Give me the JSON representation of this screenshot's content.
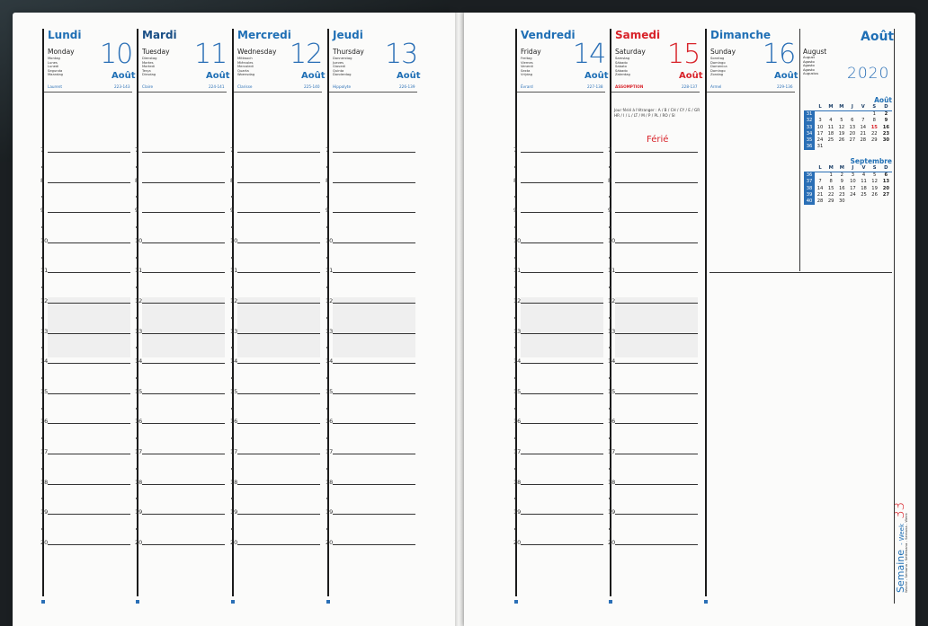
{
  "left_days": [
    {
      "name": "Lundi",
      "trans": "Monday",
      "langs": [
        "Montag",
        "Lunes",
        "Lunedi",
        "Segunda",
        "Maandag"
      ],
      "num": "10",
      "month": "Août",
      "saint": "Laurent",
      "code": "223-143",
      "style": "blue"
    },
    {
      "name": "Mardi",
      "trans": "Tuesday",
      "langs": [
        "Dienstag",
        "Martes",
        "Martedi",
        "Terça",
        "Dinsdag"
      ],
      "num": "11",
      "month": "Août",
      "saint": "Claire",
      "code": "224-141",
      "style": "dark"
    },
    {
      "name": "Mercredi",
      "trans": "Wednesday",
      "langs": [
        "Mittwoch",
        "Miércoles",
        "Mercoledi",
        "Quarta",
        "Woensdag"
      ],
      "num": "12",
      "month": "Août",
      "saint": "Clarisse",
      "code": "225-140",
      "style": "blue"
    },
    {
      "name": "Jeudi",
      "trans": "Thursday",
      "langs": [
        "Donnerstag",
        "Jueves",
        "Giovedi",
        "Quinta",
        "Donderdag"
      ],
      "num": "13",
      "month": "Août",
      "saint": "Hippolyte",
      "code": "226-139",
      "style": "blue"
    }
  ],
  "right_days": [
    {
      "name": "Vendredi",
      "trans": "Friday",
      "langs": [
        "Freitag",
        "Viernes",
        "Venerdi",
        "Sexta",
        "Vrijdag"
      ],
      "num": "14",
      "month": "Août",
      "saint": "Évrard",
      "code": "227-138",
      "style": "blue"
    },
    {
      "name": "Samedi",
      "trans": "Saturday",
      "langs": [
        "Samstag",
        "Sábado",
        "Sabato",
        "Sábado",
        "Zaterdag"
      ],
      "num": "15",
      "month": "Août",
      "saint": "ASSOMPTION",
      "code": "228-137",
      "style": "red"
    },
    {
      "name": "Dimanche",
      "trans": "Sunday",
      "langs": [
        "Sonntag",
        "Domingo",
        "Domenica",
        "Domingo",
        "Zondag"
      ],
      "num": "16",
      "month": "Août",
      "saint": "Armel",
      "code": "229-136",
      "style": "blue"
    }
  ],
  "month_panel": {
    "title": "Août",
    "trans": "August",
    "langs": [
      "August",
      "Agosto",
      "Agosto",
      "Agosto",
      "Augustus"
    ],
    "year": "2020"
  },
  "hours": [
    "7",
    "8",
    "9",
    "10",
    "11",
    "12",
    "13",
    "14",
    "15",
    "16",
    "17",
    "18",
    "19",
    "20"
  ],
  "saturday_note": "Jour férié à l'étranger : A / B / CH / CY / E / GR HR / I / L / LT / M / P / PL / RO / SI",
  "ferie_label": "Férié",
  "mini_calendars": [
    {
      "title": "Août",
      "headers": [
        "L",
        "M",
        "M",
        "J",
        "V",
        "S",
        "D"
      ],
      "rows": [
        {
          "wk": "31",
          "days": [
            "",
            "",
            "",
            "",
            "",
            "1",
            "2"
          ]
        },
        {
          "wk": "32",
          "days": [
            "3",
            "4",
            "5",
            "6",
            "7",
            "8",
            "9"
          ]
        },
        {
          "wk": "33",
          "days": [
            "10",
            "11",
            "12",
            "13",
            "14",
            "15",
            "16"
          ]
        },
        {
          "wk": "34",
          "days": [
            "17",
            "18",
            "19",
            "20",
            "21",
            "22",
            "23"
          ]
        },
        {
          "wk": "35",
          "days": [
            "24",
            "25",
            "26",
            "27",
            "28",
            "29",
            "30"
          ]
        },
        {
          "wk": "36",
          "days": [
            "31",
            "",
            "",
            "",
            "",
            "",
            ""
          ]
        }
      ],
      "red_day": "15"
    },
    {
      "title": "Septembre",
      "headers": [
        "L",
        "M",
        "M",
        "J",
        "V",
        "S",
        "D"
      ],
      "rows": [
        {
          "wk": "36",
          "days": [
            "",
            "1",
            "2",
            "3",
            "4",
            "5",
            "6"
          ]
        },
        {
          "wk": "37",
          "days": [
            "7",
            "8",
            "9",
            "10",
            "11",
            "12",
            "13"
          ]
        },
        {
          "wk": "38",
          "days": [
            "14",
            "15",
            "16",
            "17",
            "18",
            "19",
            "20"
          ]
        },
        {
          "wk": "39",
          "days": [
            "21",
            "22",
            "23",
            "24",
            "25",
            "26",
            "27"
          ]
        },
        {
          "wk": "40",
          "days": [
            "28",
            "29",
            "30",
            "",
            "",
            "",
            ""
          ]
        }
      ],
      "red_day": ""
    }
  ],
  "week_label": {
    "semaine": "Semaine",
    "week": "- Week",
    "number": "33",
    "sub": "Woche - Semana - Settimana - Semana - Week"
  }
}
